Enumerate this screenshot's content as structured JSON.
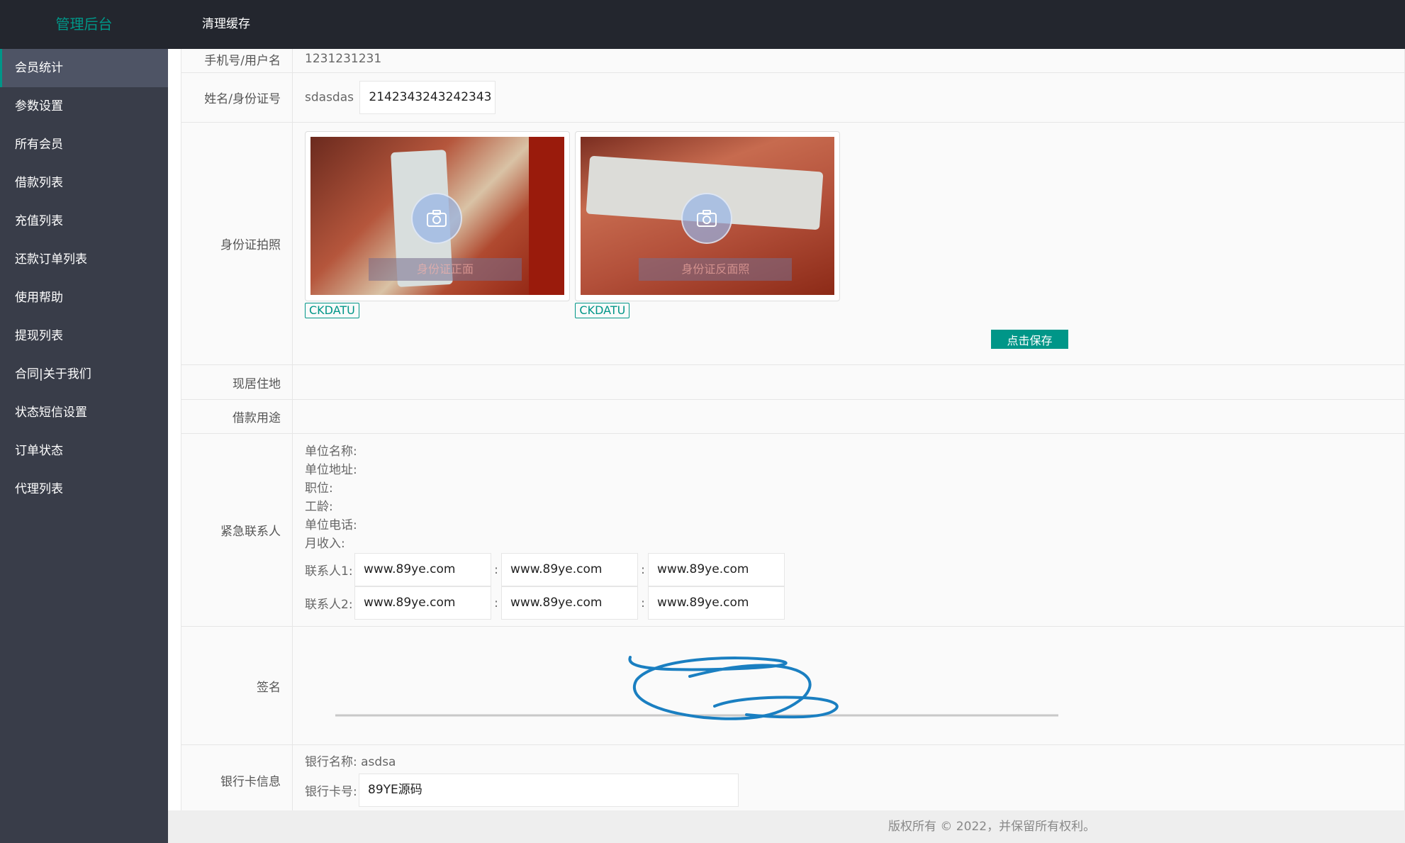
{
  "header": {
    "logo": "管理后台",
    "clear_cache": "清理缓存"
  },
  "sidebar": {
    "items": [
      {
        "label": "会员统计",
        "active": true
      },
      {
        "label": "参数设置"
      },
      {
        "label": "所有会员"
      },
      {
        "label": "借款列表"
      },
      {
        "label": "充值列表"
      },
      {
        "label": "还款订单列表"
      },
      {
        "label": "使用帮助"
      },
      {
        "label": "提现列表"
      },
      {
        "label": "合同|关于我们"
      },
      {
        "label": "状态短信设置"
      },
      {
        "label": "订单状态"
      },
      {
        "label": "代理列表"
      }
    ]
  },
  "form": {
    "phone": {
      "label": "手机号/用户名",
      "value": "1231231231"
    },
    "name_id": {
      "label": "姓名/身份证号",
      "name": "sdasdas",
      "id_number": "2142343243242343"
    },
    "id_photo": {
      "label": "身份证拍照",
      "front_label": "身份证正面",
      "back_label": "身份证反面照",
      "btn_front": "CKDATU",
      "btn_back": "CKDATU",
      "save": "点击保存"
    },
    "address": {
      "label": "现居住地",
      "value": ""
    },
    "purpose": {
      "label": "借款用途",
      "value": ""
    },
    "emergency": {
      "label": "紧急联系人",
      "lines": [
        "单位名称:",
        "单位地址:",
        "职位:",
        "工龄:",
        "单位电话:",
        "月收入:"
      ],
      "contact1": {
        "label": "联系人1:",
        "values": [
          "www.89ye.com",
          "www.89ye.com",
          "www.89ye.com"
        ]
      },
      "contact2": {
        "label": "联系人2:",
        "values": [
          "www.89ye.com",
          "www.89ye.com",
          "www.89ye.com"
        ]
      },
      "separator": ":"
    },
    "signature": {
      "label": "签名"
    },
    "bank": {
      "label": "银行卡信息",
      "bank_name": "银行名称: asdsa",
      "card_label": "银行卡号:",
      "card_value": "89YE源码"
    }
  },
  "footer": {
    "copyright": "版权所有 © 2022，并保留所有权利。"
  },
  "colors": {
    "accent": "#009688",
    "sidebar_bg": "#393d49",
    "header_bg": "#23262e",
    "signature": "#1a7fc1"
  }
}
